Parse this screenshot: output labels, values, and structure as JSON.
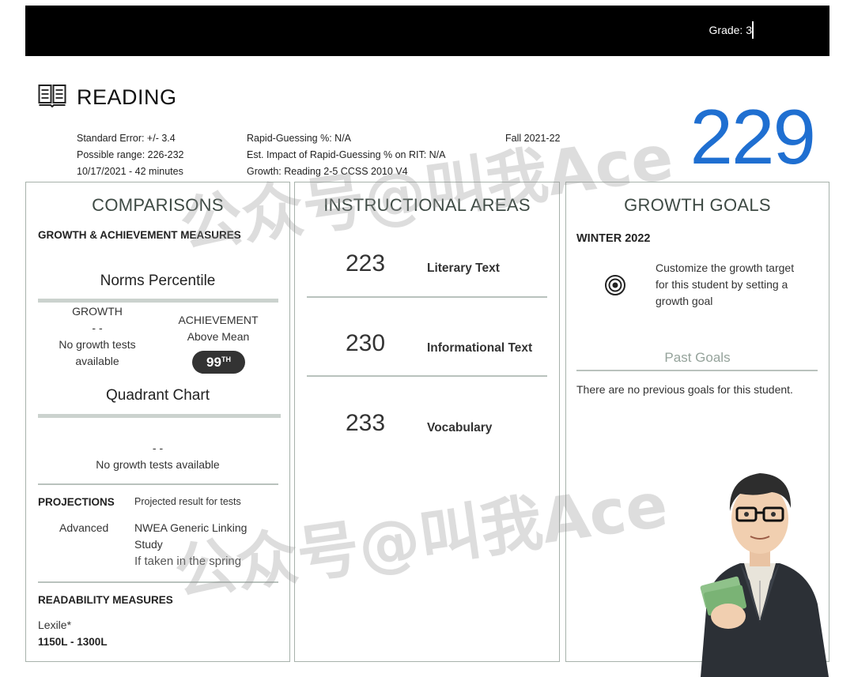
{
  "header": {
    "grade": "Grade: 3"
  },
  "subject": "READING",
  "rit_score": "229",
  "meta": {
    "standard_error": "Standard Error: +/- 3.4",
    "possible_range": "Possible range: 226-232",
    "date_duration": "10/17/2021 - 42 minutes",
    "rapid_guessing": "Rapid-Guessing %: N/A",
    "rapid_impact": "Est. Impact of Rapid-Guessing % on RIT: N/A",
    "growth": "Growth: Reading 2-5 CCSS 2010 V4",
    "term": "Fall 2021-22"
  },
  "comparisons": {
    "title": "COMPARISONS",
    "subtitle": "GROWTH & ACHIEVEMENT MEASURES",
    "norms_title": "Norms Percentile",
    "growth_label": "GROWTH",
    "growth_dash": "- -",
    "growth_note_1": "No growth tests",
    "growth_note_2": "available",
    "achievement_label": "ACHIEVEMENT",
    "achievement_value": "Above Mean",
    "percentile": "99",
    "percentile_suffix": "TH",
    "quadrant_title": "Quadrant Chart",
    "quadrant_dash": "- -",
    "quadrant_note": "No growth tests available",
    "projections_label": "PROJECTIONS",
    "projections_caption": "Projected result for tests",
    "projection_level": "Advanced",
    "projection_study_1": "NWEA Generic Linking",
    "projection_study_2": "Study",
    "projection_when": "If taken in the spring",
    "readability_label": "READABILITY MEASURES",
    "lexile_label": "Lexile*",
    "lexile_range": "1150L - 1300L"
  },
  "instructional": {
    "title": "INSTRUCTIONAL AREAS",
    "areas": [
      {
        "score": "223",
        "label": "Literary Text"
      },
      {
        "score": "230",
        "label": "Informational Text"
      },
      {
        "score": "233",
        "label": "Vocabulary"
      }
    ]
  },
  "growth_goals": {
    "title": "GROWTH GOALS",
    "season": "WINTER 2022",
    "customize_1": "Customize the growth target",
    "customize_2": "for this student by setting a",
    "customize_3": "growth goal",
    "past_goals": "Past Goals",
    "no_goals": "There are no previous goals for this student."
  },
  "watermark": "公众号@叫我Ace",
  "icons": {
    "book": "book-icon",
    "target": "target-icon"
  },
  "colors": {
    "rit": "#1f6fd1",
    "panel_border": "#a7b2ab"
  }
}
